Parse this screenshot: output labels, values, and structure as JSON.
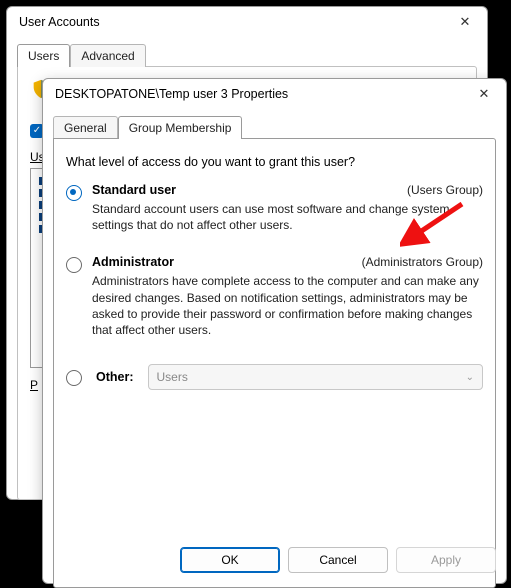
{
  "parent_window": {
    "title": "User Accounts",
    "tab_users": "Users",
    "tab_advanced": "Advanced",
    "list_label": "Us",
    "prop_label": "P"
  },
  "properties_window": {
    "title": "DESKTOPATONE\\Temp user 3 Properties",
    "tab_general": "General",
    "tab_group": "Group Membership",
    "question": "What level of access do you want to grant this user?",
    "option_standard": {
      "title": "Standard user",
      "group": "(Users Group)",
      "desc": "Standard account users can use most software and change system settings that do not affect other users."
    },
    "option_admin": {
      "title": "Administrator",
      "group": "(Administrators Group)",
      "desc": "Administrators have complete access to the computer and can make any desired changes. Based on notification settings, administrators may be asked to provide their password or confirmation before making changes that affect other users."
    },
    "option_other": {
      "title": "Other:",
      "combo_value": "Users"
    },
    "buttons": {
      "ok": "OK",
      "cancel": "Cancel",
      "apply": "Apply"
    }
  }
}
